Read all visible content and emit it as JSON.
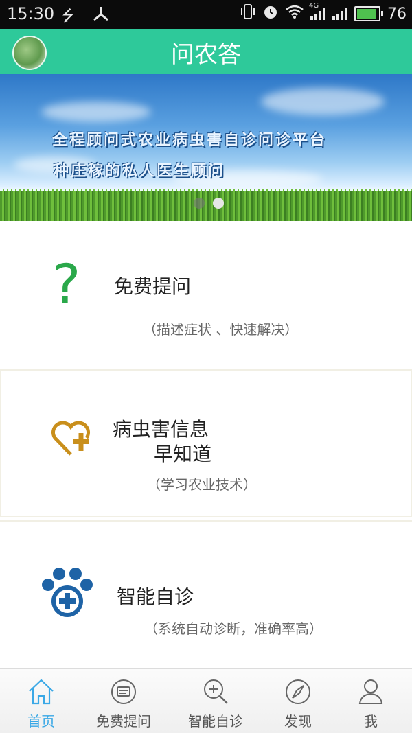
{
  "status_bar": {
    "time": "15:30",
    "network_label": "4G",
    "battery_level": "76",
    "battery_fill": 0.8
  },
  "header": {
    "title": "问农答"
  },
  "banner": {
    "line1": "全程顾问式农业病虫害自诊问诊平台",
    "line2": "种庄稼的私人医生顾问",
    "slide_index": 2,
    "slide_count": 2
  },
  "cards": [
    {
      "title": "免费提问",
      "subtitle": "（描述症状 、快速解决）",
      "icon": "question-icon"
    },
    {
      "title_line1": "病虫害信息",
      "title_line2": "早知道",
      "subtitle": "（学习农业技术）",
      "icon": "heart-plus-icon"
    },
    {
      "title": "智能自诊",
      "subtitle": "（系统自动诊断，准确率高）",
      "icon": "paw-plus-icon"
    }
  ],
  "tabs": [
    {
      "label": "首页",
      "icon": "home-icon",
      "active": true
    },
    {
      "label": "免费提问",
      "icon": "chat-icon",
      "active": false
    },
    {
      "label": "智能自诊",
      "icon": "zoom-in-icon",
      "active": false
    },
    {
      "label": "发现",
      "icon": "compass-icon",
      "active": false
    },
    {
      "label": "我",
      "icon": "person-icon",
      "active": false
    }
  ],
  "colors": {
    "header_bg": "#2ec99a",
    "active_tab": "#3aa8e6",
    "question_green": "#2aa84a",
    "heart_gold": "#c98f1c",
    "paw_blue": "#1e63a6"
  }
}
